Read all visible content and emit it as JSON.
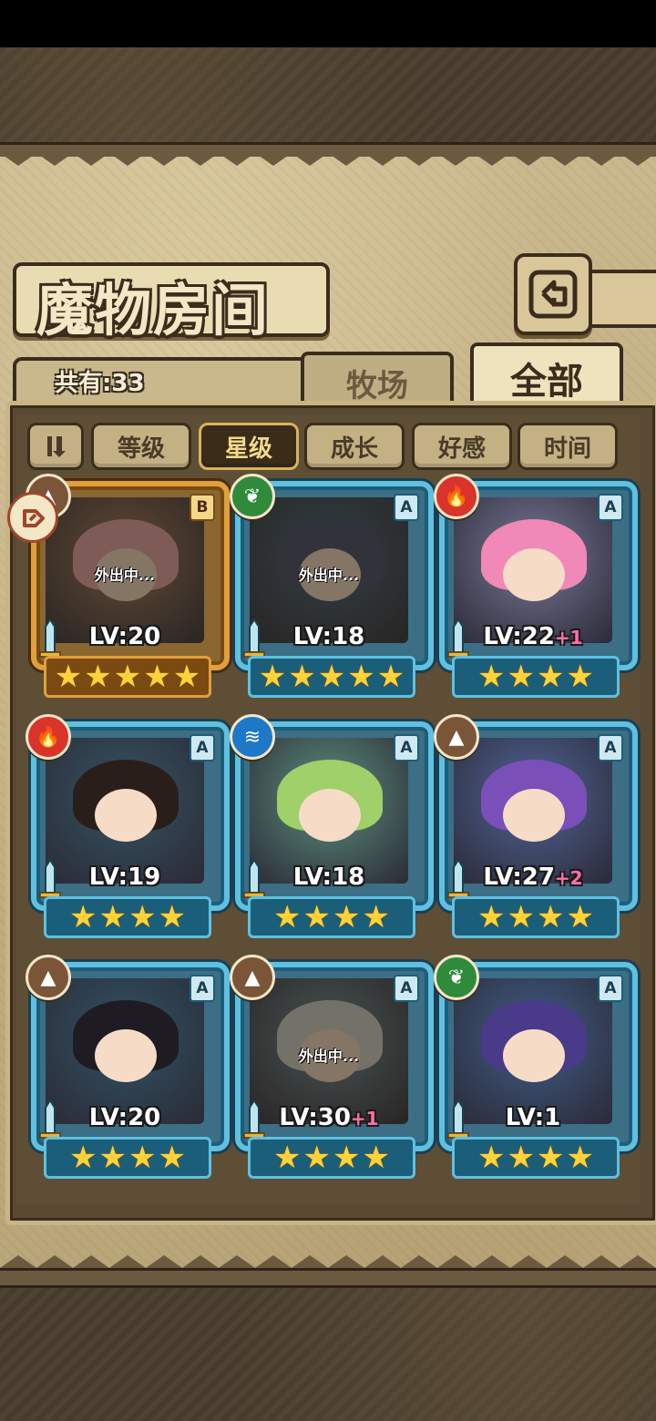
{
  "header": {
    "title": "魔物房间"
  },
  "tabs": {
    "count_label": "共有:33",
    "ranch": "牧场",
    "all": "全部"
  },
  "sort": {
    "buttons": [
      "等级",
      "星级",
      "成长",
      "好感",
      "时间"
    ],
    "active": "星级"
  },
  "colors": {
    "fire": "#d9332b",
    "grass": "#2f8a3a",
    "water": "#1e78c8",
    "earth": "#7a5538"
  },
  "monsters": [
    {
      "rank": "B",
      "element": "earth",
      "level": "LV:20",
      "bonus": "",
      "stars": 5,
      "status": "外出中...",
      "hair": "#e8a2a6"
    },
    {
      "rank": "A",
      "element": "grass",
      "level": "LV:18",
      "bonus": "",
      "stars": 5,
      "status": "外出中...",
      "hair": "#3e4a66"
    },
    {
      "rank": "A",
      "element": "fire",
      "level": "LV:22",
      "bonus": "+1",
      "stars": 4,
      "status": "",
      "hair": "#f089b8"
    },
    {
      "rank": "A",
      "element": "fire",
      "level": "LV:19",
      "bonus": "",
      "stars": 4,
      "status": "",
      "hair": "#2a1e1a"
    },
    {
      "rank": "A",
      "element": "water",
      "level": "LV:18",
      "bonus": "",
      "stars": 4,
      "status": "",
      "hair": "#9fd06a"
    },
    {
      "rank": "A",
      "element": "earth",
      "level": "LV:27",
      "bonus": "+2",
      "stars": 4,
      "status": "",
      "hair": "#7a4fb8"
    },
    {
      "rank": "A",
      "element": "earth",
      "level": "LV:20",
      "bonus": "",
      "stars": 4,
      "status": "",
      "hair": "#1e1c22"
    },
    {
      "rank": "A",
      "element": "earth",
      "level": "LV:30",
      "bonus": "+1",
      "stars": 4,
      "status": "外出中...",
      "hair": "#cfd2cc"
    },
    {
      "rank": "A",
      "element": "grass",
      "level": "LV:1",
      "bonus": "",
      "stars": 4,
      "status": "",
      "hair": "#4a3a8a"
    }
  ]
}
